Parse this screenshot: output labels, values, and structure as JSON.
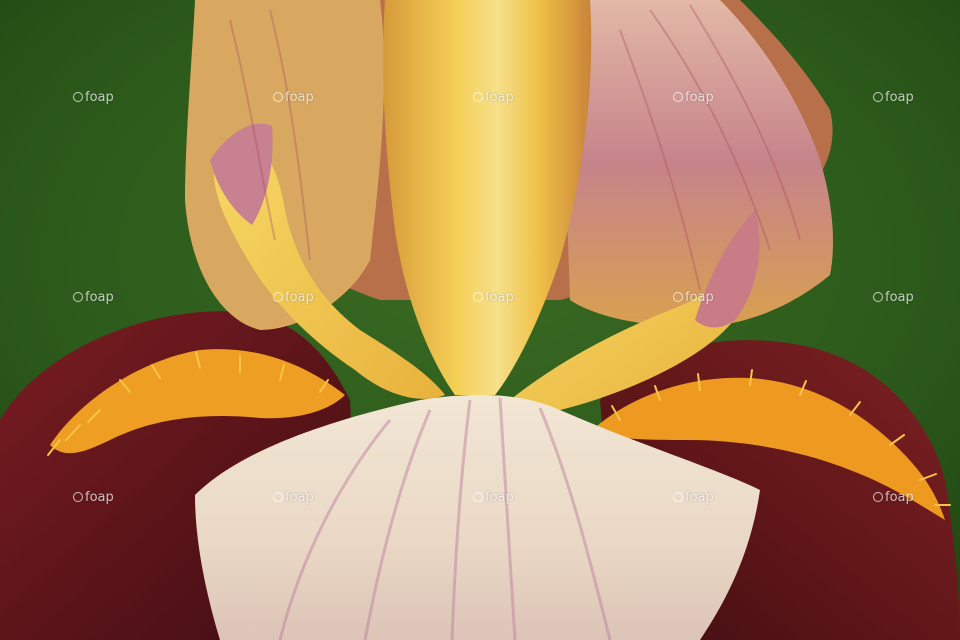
{
  "photo": {
    "subject": "iris-flower-macro",
    "colors": {
      "background_green": "#2e5a1c",
      "fall_maroon": "#6b1a1f",
      "beard_orange": "#f0a020",
      "standard_yellow": "#f2c640",
      "standard_mauve": "#c67a86",
      "center_petal_cream": "#efe0c8"
    }
  },
  "watermark": {
    "text": "foap"
  }
}
